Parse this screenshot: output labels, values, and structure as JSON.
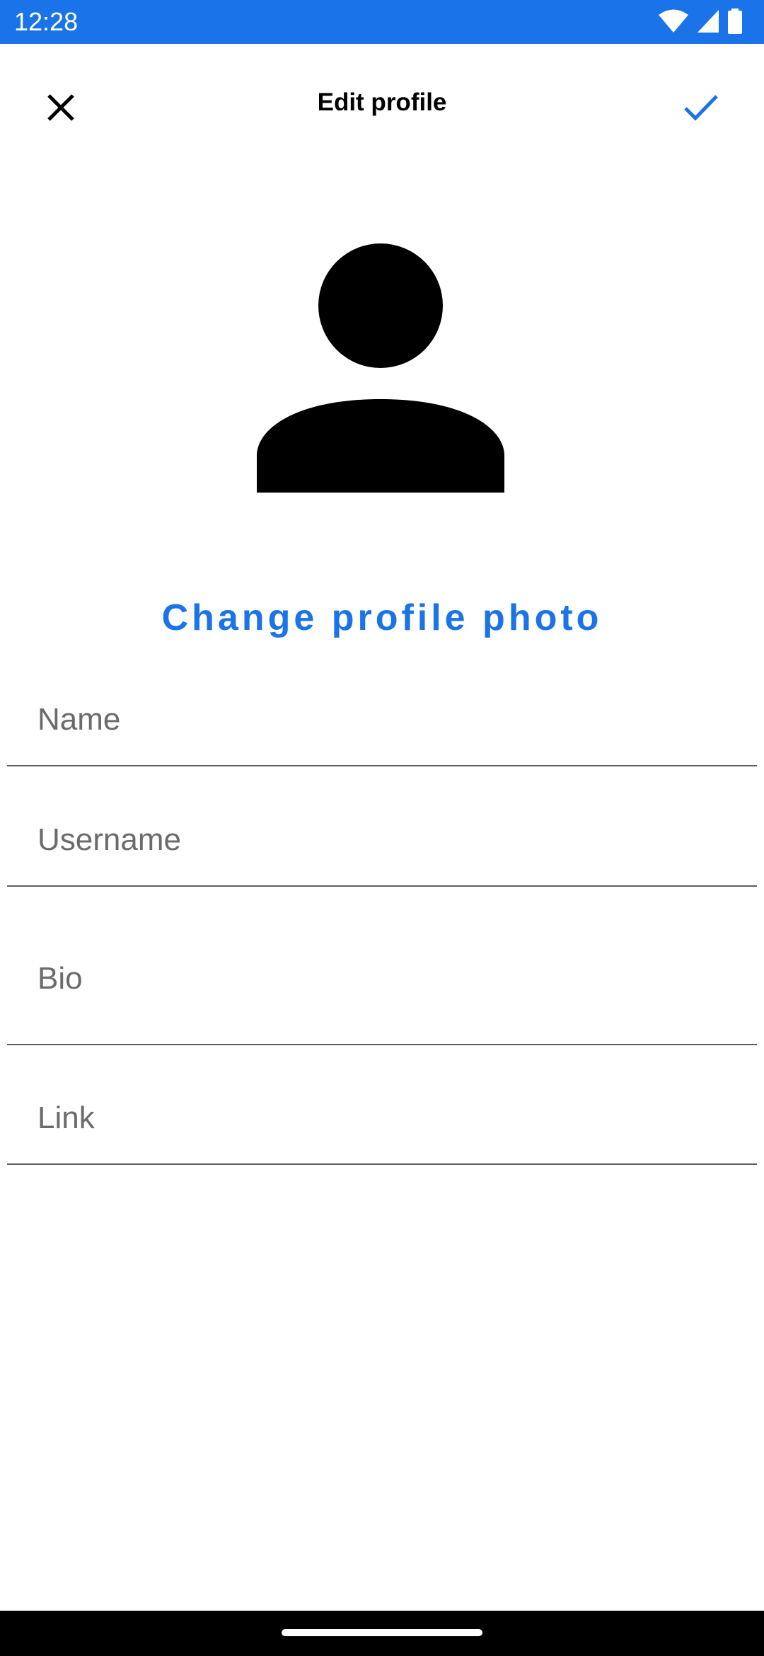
{
  "status_bar": {
    "time": "12:28",
    "icons": [
      "wifi-icon",
      "cellular-signal-icon",
      "battery-icon"
    ],
    "background": "#1a73e8"
  },
  "toolbar": {
    "title": "Edit profile",
    "close_icon": "close-icon",
    "save_icon": "check-icon",
    "accent": "#1a73e8"
  },
  "profile": {
    "avatar_icon": "person-icon",
    "change_photo_label": "Change profile photo"
  },
  "form": {
    "name_placeholder": "Name",
    "username_placeholder": "Username",
    "bio_placeholder": "Bio",
    "link_placeholder": "Link"
  }
}
